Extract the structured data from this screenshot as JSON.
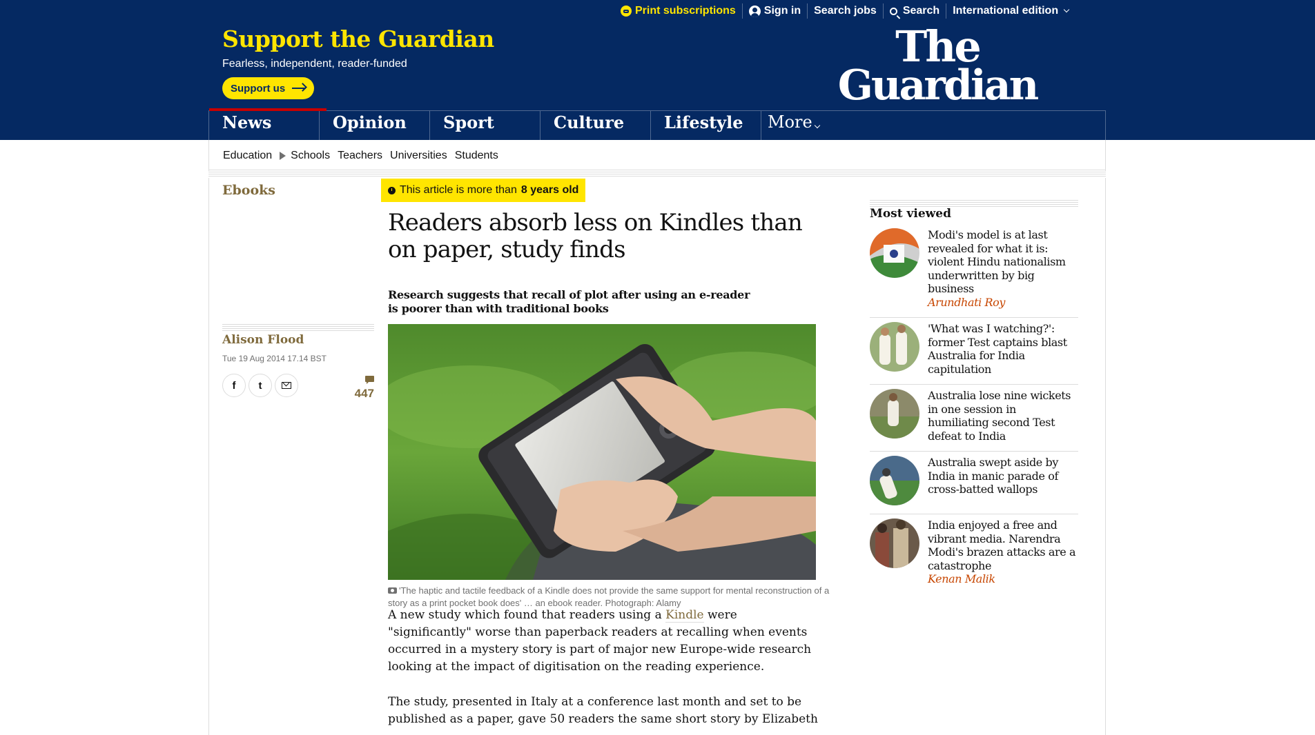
{
  "topbar": {
    "print_subscriptions": "Print subscriptions",
    "sign_in": "Sign in",
    "search_jobs": "Search jobs",
    "search": "Search",
    "edition": "International edition"
  },
  "support": {
    "title": "Support the Guardian",
    "subtitle": "Fearless, independent, reader-funded",
    "button": "Support us"
  },
  "logo": {
    "line1": "The",
    "line2": "Guardian"
  },
  "nav": {
    "pillars": [
      "News",
      "Opinion",
      "Sport",
      "Culture",
      "Lifestyle"
    ],
    "more": "More"
  },
  "subnav": {
    "items": [
      "Education",
      "Schools",
      "Teachers",
      "Universities",
      "Students"
    ]
  },
  "article": {
    "series": "Ebooks",
    "age_prefix": "This article is more than",
    "age_value": "8 years old",
    "headline": "Readers absorb less on Kindles than on paper, study finds",
    "standfirst": "Research suggests that recall of plot after using an e-reader is poorer than with traditional books",
    "byline": "Alison Flood",
    "date": "Tue 19 Aug 2014 17.14 BST",
    "comment_count": "447",
    "caption": "'The haptic and tactile feedback of a Kindle does not provide the same support for mental reconstruction of a story as a print pocket book does' … an ebook reader. Photograph: Alamy",
    "p1_a": "A new study which found that readers using a ",
    "p1_link": "Kindle",
    "p1_b": " were \"significantly\" worse than paperback readers at recalling when events occurred in a mystery story is part of major new Europe-wide research looking at the impact of digitisation on the reading experience.",
    "p2": "The study, presented in Italy at a conference last month and set to be published as a paper, gave 50 readers the same short story by Elizabeth"
  },
  "share": {
    "facebook": "f",
    "twitter": "t"
  },
  "most_viewed": {
    "title": "Most viewed",
    "items": [
      {
        "headline": "Modi's model is at last revealed for what it is: violent Hindu nationalism underwritten by big business",
        "author": "Arundhati Roy"
      },
      {
        "headline": "'What was I watching?': former Test captains blast Australia for India capitulation",
        "author": ""
      },
      {
        "headline": "Australia lose nine wickets in one session in humiliating second Test defeat to India",
        "author": ""
      },
      {
        "headline": "Australia swept aside by India in manic parade of cross-batted wallops",
        "author": ""
      },
      {
        "headline": "India enjoyed a free and vibrant media. Narendra Modi's brazen attacks are a catastrophe",
        "author": "Kenan Malik"
      }
    ]
  },
  "colors": {
    "brand_blue": "#052962",
    "support_yellow": "#ffe500",
    "news_red": "#c70000",
    "culture_brown": "#7f6a3c",
    "opinion_orange": "#c74600"
  }
}
